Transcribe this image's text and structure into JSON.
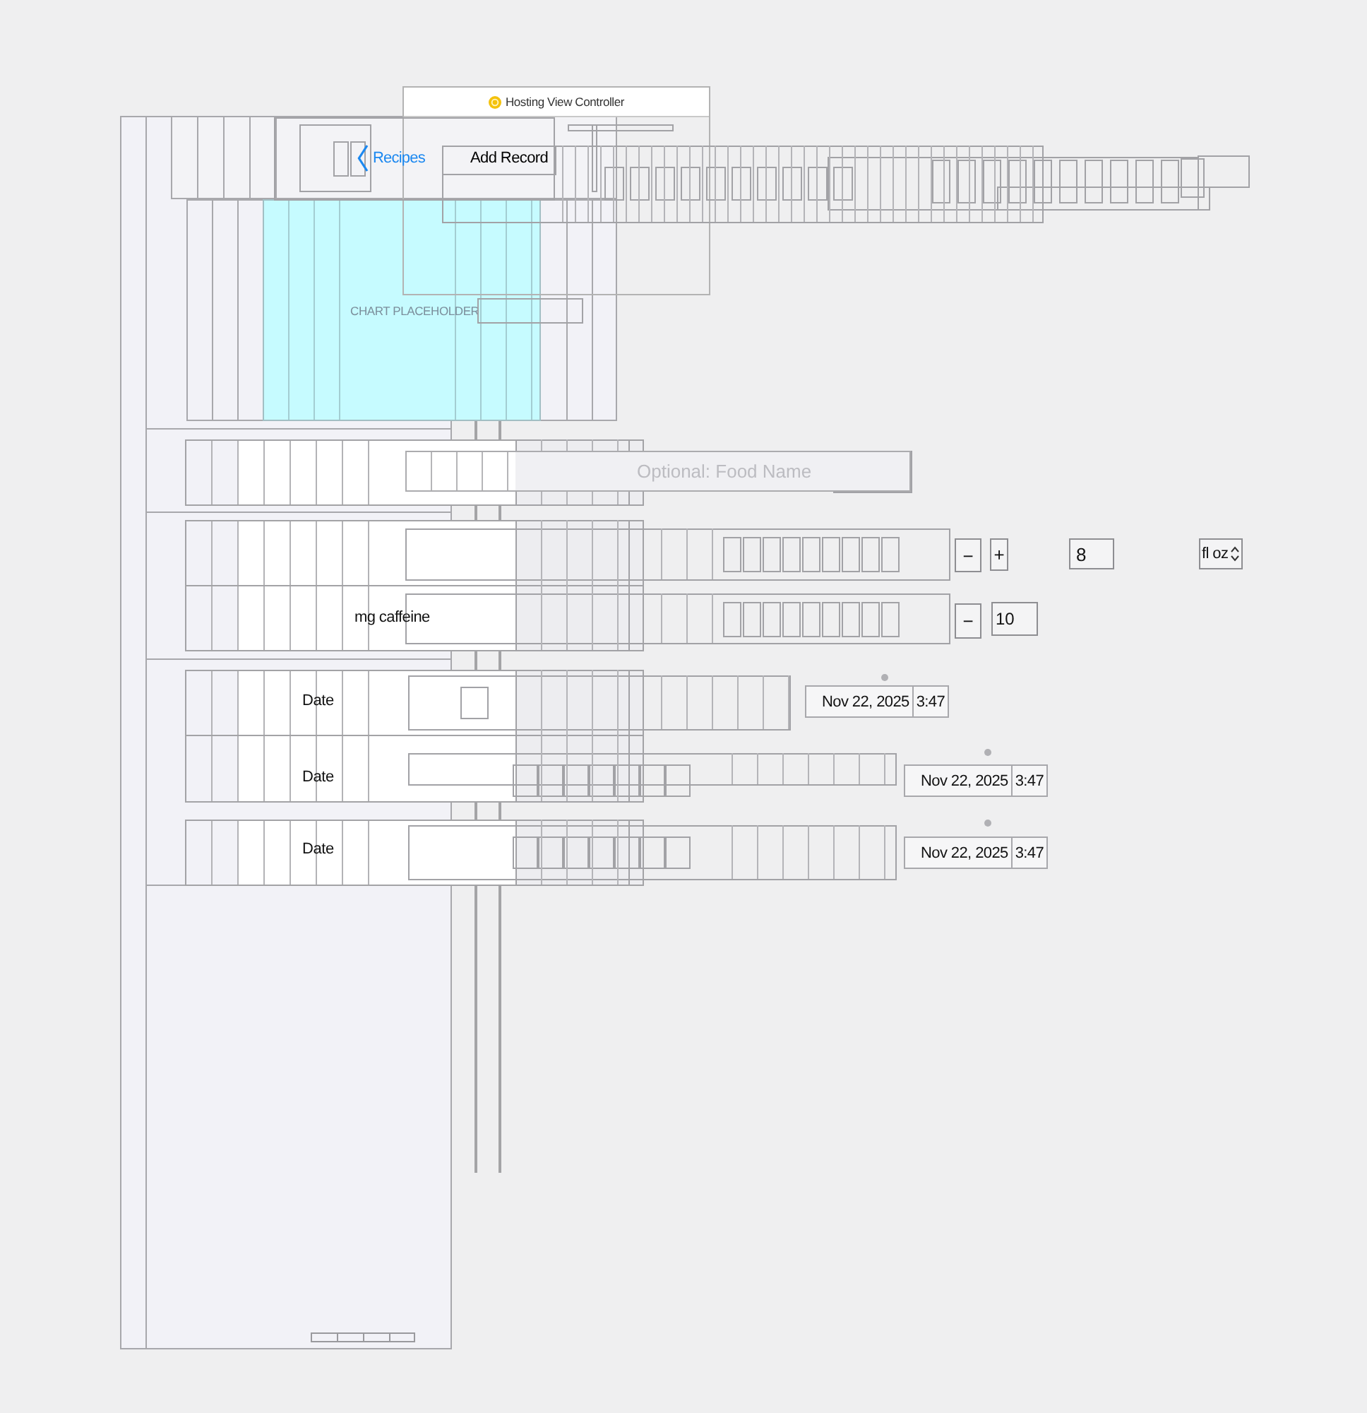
{
  "window": {
    "title": "Hosting View Controller"
  },
  "navigation_bar": {
    "back_button": "Recipes",
    "title": "Add Record"
  },
  "chart": {
    "placeholder": "CHART PLACEHOLDER"
  },
  "food_name": {
    "placeholder": "Optional: Food Name"
  },
  "volume": {
    "decrement": "−",
    "increment": "+",
    "value": "8",
    "unit": "fl oz"
  },
  "caffeine": {
    "label": "mg caffeine",
    "decrement": "−",
    "value": "10"
  },
  "date_rows": [
    {
      "label": "Date",
      "date": "Nov 22, 2025",
      "time": "3:47"
    },
    {
      "label": "Date",
      "date": "Nov 22, 2025",
      "time": "3:47"
    },
    {
      "label": "Date",
      "date": "Nov 22, 2025",
      "time": "3:47"
    }
  ]
}
